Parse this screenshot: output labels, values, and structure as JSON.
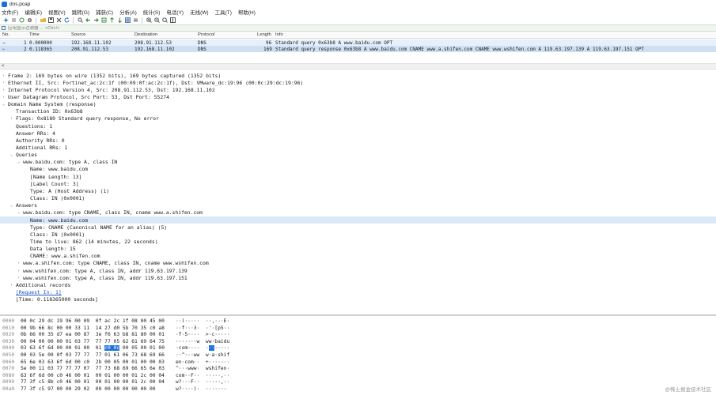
{
  "window": {
    "title": "dns.pcap"
  },
  "menu": [
    "文件(F)",
    "编辑(E)",
    "视图(V)",
    "跳转(G)",
    "捕获(C)",
    "分析(A)",
    "统计(S)",
    "电话(Y)",
    "无线(W)",
    "工具(T)",
    "帮助(H)"
  ],
  "filter": {
    "placeholder": "应用显示过滤器 … <Ctrl-/>"
  },
  "packet_list": {
    "columns": [
      "No.",
      "Time",
      "Source",
      "Destination",
      "Protocol",
      "Length",
      "Info"
    ],
    "rows": [
      {
        "no": "1",
        "time": "0.000000",
        "source": "192.168.11.102",
        "destination": "208.91.112.53",
        "protocol": "DNS",
        "length": "96",
        "info": "Standard query 0x63b8 A www.baidu.com OPT"
      },
      {
        "no": "2",
        "time": "0.118365",
        "source": "208.91.112.53",
        "destination": "192.168.11.102",
        "protocol": "DNS",
        "length": "169",
        "info": "Standard query response 0x63b8 A www.baidu.com CNAME www.a.shifen.com CNAME www.wshifen.com A 119.63.197.139 A 119.63.197.151 OPT"
      }
    ]
  },
  "details": [
    {
      "text": "Frame 2: 169 bytes on wire (1352 bits), 169 bytes captured (1352 bits)",
      "indent": 0,
      "toggle": ">"
    },
    {
      "text": "Ethernet II, Src: Fortinet_ac:2c:1f (00:09:0f:ac:2c:1f), Dst: VMware_dc:19:96 (00:0c:29:dc:19:96)",
      "indent": 0,
      "toggle": ">"
    },
    {
      "text": "Internet Protocol Version 4, Src: 208.91.112.53, Dst: 192.168.11.102",
      "indent": 0,
      "toggle": ">"
    },
    {
      "text": "User Datagram Protocol, Src Port: 53, Dst Port: 55274",
      "indent": 0,
      "toggle": ">"
    },
    {
      "text": "Domain Name System (response)",
      "indent": 0,
      "toggle": "v"
    },
    {
      "text": "Transaction ID: 0x63b8",
      "indent": 1,
      "toggle": ""
    },
    {
      "text": "Flags: 0x8180 Standard query response, No error",
      "indent": 1,
      "toggle": ">"
    },
    {
      "text": "Questions: 1",
      "indent": 1,
      "toggle": ""
    },
    {
      "text": "Answer RRs: 4",
      "indent": 1,
      "toggle": ""
    },
    {
      "text": "Authority RRs: 0",
      "indent": 1,
      "toggle": ""
    },
    {
      "text": "Additional RRs: 1",
      "indent": 1,
      "toggle": ""
    },
    {
      "text": "Queries",
      "indent": 1,
      "toggle": "v"
    },
    {
      "text": "www.baidu.com: type A, class IN",
      "indent": 2,
      "toggle": "v"
    },
    {
      "text": "Name: www.baidu.com",
      "indent": 3,
      "toggle": ""
    },
    {
      "text": "[Name Length: 13]",
      "indent": 3,
      "toggle": ""
    },
    {
      "text": "[Label Count: 3]",
      "indent": 3,
      "toggle": ""
    },
    {
      "text": "Type: A (Host Address) (1)",
      "indent": 3,
      "toggle": ""
    },
    {
      "text": "Class: IN (0x0001)",
      "indent": 3,
      "toggle": ""
    },
    {
      "text": "Answers",
      "indent": 1,
      "toggle": "v"
    },
    {
      "text": "www.baidu.com: type CNAME, class IN, cname www.a.shifen.com",
      "indent": 2,
      "toggle": "v"
    },
    {
      "text": "Name: www.baidu.com",
      "indent": 3,
      "toggle": "",
      "selected": true
    },
    {
      "text": "Type: CNAME (Canonical NAME for an alias) (5)",
      "indent": 3,
      "toggle": ""
    },
    {
      "text": "Class: IN (0x0001)",
      "indent": 3,
      "toggle": ""
    },
    {
      "text": "Time to live: 862 (14 minutes, 22 seconds)",
      "indent": 3,
      "toggle": ""
    },
    {
      "text": "Data length: 15",
      "indent": 3,
      "toggle": ""
    },
    {
      "text": "CNAME: www.a.shifen.com",
      "indent": 3,
      "toggle": ""
    },
    {
      "text": "www.a.shifen.com: type CNAME, class IN, cname www.wshifen.com",
      "indent": 2,
      "toggle": ">"
    },
    {
      "text": "www.wshifen.com: type A, class IN, addr 119.63.197.139",
      "indent": 2,
      "toggle": ">"
    },
    {
      "text": "www.wshifen.com: type A, class IN, addr 119.63.197.151",
      "indent": 2,
      "toggle": ">"
    },
    {
      "text": "Additional records",
      "indent": 1,
      "toggle": ">"
    },
    {
      "text": "[Request In: 1]",
      "indent": 1,
      "toggle": "",
      "link": true
    },
    {
      "text": "[Time: 0.118365000 seconds]",
      "indent": 1,
      "toggle": ""
    }
  ],
  "bytes": [
    {
      "offset": "0000",
      "hex": "00 0c 29 dc 19 96 00 09  0f ac 2c 1f 08 00 45 00",
      "ascii": "··)·····  ··,···E·"
    },
    {
      "offset": "0010",
      "hex": "00 9b 66 8c 00 00 33 11  14 27 d0 5b 70 35 c0 a8",
      "ascii": "··f···3·  ·'·[p5··"
    },
    {
      "offset": "0020",
      "hex": "0b 66 00 35 d7 ea 00 87  3e f6 63 b8 81 80 00 01",
      "ascii": "·f·5····  >·c·····"
    },
    {
      "offset": "0030",
      "hex": "00 04 00 00 00 01 03 77  77 77 05 62 61 69 64 75",
      "ascii": "·······w  ww·baidu"
    },
    {
      "offset": "0040",
      "hex_pre": "03 63 6f 6d 00 00 01 00  01 ",
      "hex_hl": "c0 0c",
      "hex_post": " 00 05 00 01 00",
      "ascii_pre": "·com····  ·",
      "ascii_hl": "··",
      "ascii_post": "·····"
    },
    {
      "offset": "0050",
      "hex": "00 03 5e 00 0f 03 77 77  77 01 61 06 73 68 69 66",
      "ascii": "··^···ww  w·a·shif"
    },
    {
      "offset": "0060",
      "hex": "65 6e 03 63 6f 6d 00 c0  2b 00 05 00 01 00 00 03",
      "ascii": "en·com··  +·······"
    },
    {
      "offset": "0070",
      "hex": "5e 00 11 03 77 77 77 07  77 73 68 69 66 65 6e 03",
      "ascii": "^···www·  wshifen·"
    },
    {
      "offset": "0080",
      "hex": "63 6f 6d 00 c0 46 00 01  00 01 00 00 01 2c 00 04",
      "ascii": "com··F··  ·····,··"
    },
    {
      "offset": "0090",
      "hex": "77 3f c5 8b c0 46 00 01  00 01 00 00 01 2c 00 04",
      "ascii": "w?···F··  ·····,··"
    },
    {
      "offset": "00a0",
      "hex": "77 3f c5 97 00 00 29 02  00 00 00 00 00 00 00",
      "ascii": "w?····)·  ·······"
    }
  ],
  "watermark": "@稀土掘金技术社区"
}
